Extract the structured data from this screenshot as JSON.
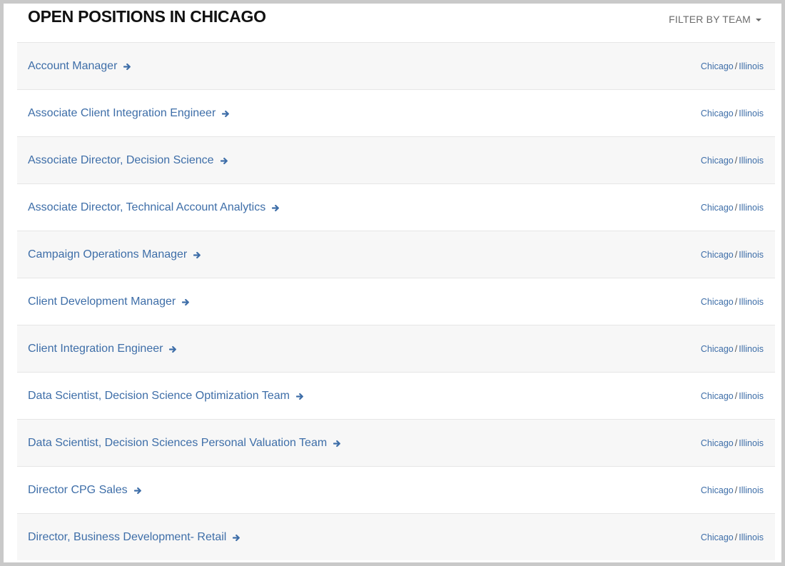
{
  "header": {
    "title": "OPEN POSITIONS IN CHICAGO",
    "filter_label": "FILTER BY TEAM"
  },
  "jobs": [
    {
      "title": "Account Manager",
      "city": "Chicago",
      "state": "Illinois"
    },
    {
      "title": "Associate Client Integration Engineer",
      "city": "Chicago",
      "state": "Illinois"
    },
    {
      "title": "Associate Director, Decision Science",
      "city": "Chicago",
      "state": "Illinois"
    },
    {
      "title": "Associate Director, Technical Account Analytics",
      "city": "Chicago",
      "state": "Illinois"
    },
    {
      "title": "Campaign Operations Manager",
      "city": "Chicago",
      "state": "Illinois"
    },
    {
      "title": "Client Development Manager",
      "city": "Chicago",
      "state": "Illinois"
    },
    {
      "title": "Client Integration Engineer",
      "city": "Chicago",
      "state": "Illinois"
    },
    {
      "title": "Data Scientist, Decision Science Optimization Team",
      "city": "Chicago",
      "state": "Illinois"
    },
    {
      "title": "Data Scientist, Decision Sciences Personal Valuation Team",
      "city": "Chicago",
      "state": "Illinois"
    },
    {
      "title": "Director CPG Sales",
      "city": "Chicago",
      "state": "Illinois"
    },
    {
      "title": "Director, Business Development- Retail",
      "city": "Chicago",
      "state": "Illinois"
    }
  ],
  "separator": "/",
  "icons": {
    "job_link": "arrow-right-icon",
    "filter": "caret-down-icon"
  },
  "colors": {
    "link": "#3e6ea8",
    "row_alt": "#f7f7f7",
    "title": "#111111"
  }
}
